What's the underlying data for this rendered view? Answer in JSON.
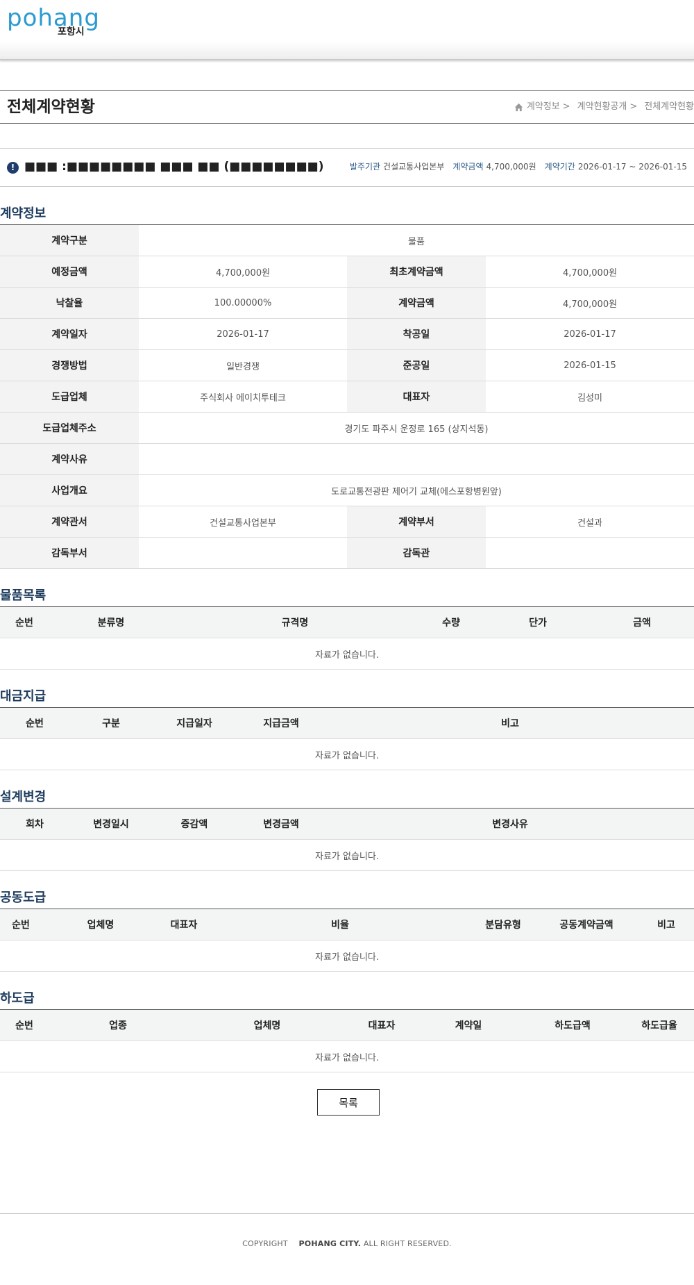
{
  "header": {
    "logo_text": "pohang",
    "logo_sub": "포항시"
  },
  "page": {
    "title": "전체계약현황"
  },
  "breadcrumb": [
    {
      "label": "계약정보",
      "sep": ">"
    },
    {
      "label": "계약현황공개",
      "sep": ">"
    },
    {
      "label": "전체계약현황",
      "sep": ""
    }
  ],
  "summary": {
    "title": "■■■ :■■■■■■■■ ■■■ ■■ (■■■■■■■■)",
    "order_org_label": "발주기관",
    "order_org": "건설교통사업본부",
    "amount_label": "계약금액",
    "amount": "4,700,000원",
    "period_label": "계약기간",
    "period": "2026-01-17 ~ 2026-01-15"
  },
  "contract_info": {
    "title": "계약정보",
    "type_label": "계약구분",
    "type": "물품",
    "est_amount_label": "예정금액",
    "est_amount": "4,700,000원",
    "init_amount_label": "최초계약금액",
    "init_amount": "4,700,000원",
    "rate_label": "낙찰율",
    "rate": "100.00000%",
    "amount_label": "계약금액",
    "amount": "4,700,000원",
    "date_label": "계약일자",
    "date": "2026-01-17",
    "start_label": "착공일",
    "start": "2026-01-17",
    "method_label": "경쟁방법",
    "method": "일반경쟁",
    "complete_label": "준공일",
    "complete": "2026-01-15",
    "company_label": "도급업체",
    "company": "주식회사 에이치투테크",
    "ceo_label": "대표자",
    "ceo": "김성미",
    "address_label": "도급업체주소",
    "address": "경기도 파주시 운정로 165 (상지석동)",
    "reason_label": "계약사유",
    "reason": "",
    "overview_label": "사업개요",
    "overview": "도로교통전광판 제어기 교체(에스포항병원앞)",
    "office_label": "계약관서",
    "office": "건설교통사업본부",
    "dept_label": "계약부서",
    "dept": "건설과",
    "sup_dept_label": "감독부서",
    "sup_dept": "",
    "supervisor_label": "감독관",
    "supervisor": ""
  },
  "goods": {
    "title": "물품목록",
    "headers": [
      "순번",
      "분류명",
      "규격명",
      "수량",
      "단가",
      "금액"
    ],
    "empty": "자료가 없습니다."
  },
  "payment": {
    "title": "대금지급",
    "headers": [
      "순번",
      "구분",
      "지급일자",
      "지급금액",
      "비고"
    ],
    "empty": "자료가 없습니다."
  },
  "design_change": {
    "title": "설계변경",
    "headers": [
      "회차",
      "변경일시",
      "증감액",
      "변경금액",
      "변경사유"
    ],
    "empty": "자료가 없습니다."
  },
  "joint": {
    "title": "공동도급",
    "headers": [
      "순번",
      "업체명",
      "대표자",
      "비율",
      "분담유형",
      "공동계약금액",
      "비고"
    ],
    "empty": "자료가 없습니다."
  },
  "sub": {
    "title": "하도급",
    "headers": [
      "순번",
      "업종",
      "업체명",
      "대표자",
      "계약일",
      "하도급액",
      "하도급율"
    ],
    "empty": "자료가 없습니다."
  },
  "buttons": {
    "list": "목록"
  },
  "footer": {
    "copyright": "COPYRIGHT",
    "org": "POHANG CITY.",
    "rights": "ALL RIGHT RESERVED."
  }
}
